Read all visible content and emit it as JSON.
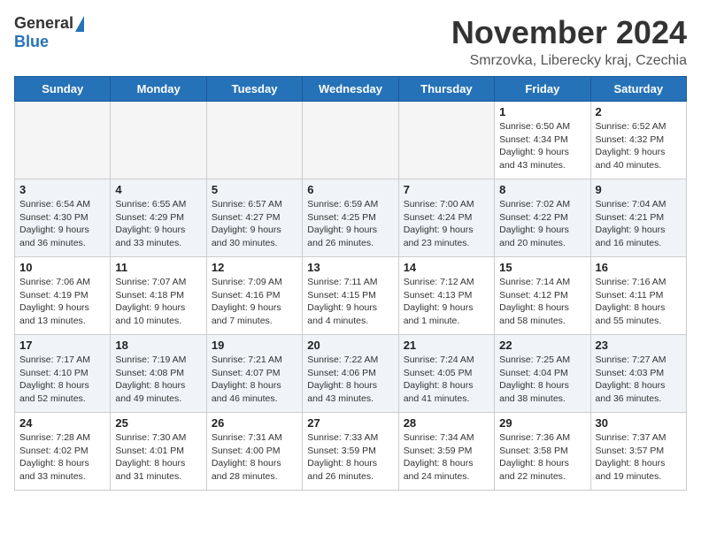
{
  "header": {
    "logo_general": "General",
    "logo_blue": "Blue",
    "title": "November 2024",
    "location": "Smrzovka, Liberecky kraj, Czechia"
  },
  "weekdays": [
    "Sunday",
    "Monday",
    "Tuesday",
    "Wednesday",
    "Thursday",
    "Friday",
    "Saturday"
  ],
  "weeks": [
    [
      {
        "day": "",
        "info": ""
      },
      {
        "day": "",
        "info": ""
      },
      {
        "day": "",
        "info": ""
      },
      {
        "day": "",
        "info": ""
      },
      {
        "day": "",
        "info": ""
      },
      {
        "day": "1",
        "info": "Sunrise: 6:50 AM\nSunset: 4:34 PM\nDaylight: 9 hours\nand 43 minutes."
      },
      {
        "day": "2",
        "info": "Sunrise: 6:52 AM\nSunset: 4:32 PM\nDaylight: 9 hours\nand 40 minutes."
      }
    ],
    [
      {
        "day": "3",
        "info": "Sunrise: 6:54 AM\nSunset: 4:30 PM\nDaylight: 9 hours\nand 36 minutes."
      },
      {
        "day": "4",
        "info": "Sunrise: 6:55 AM\nSunset: 4:29 PM\nDaylight: 9 hours\nand 33 minutes."
      },
      {
        "day": "5",
        "info": "Sunrise: 6:57 AM\nSunset: 4:27 PM\nDaylight: 9 hours\nand 30 minutes."
      },
      {
        "day": "6",
        "info": "Sunrise: 6:59 AM\nSunset: 4:25 PM\nDaylight: 9 hours\nand 26 minutes."
      },
      {
        "day": "7",
        "info": "Sunrise: 7:00 AM\nSunset: 4:24 PM\nDaylight: 9 hours\nand 23 minutes."
      },
      {
        "day": "8",
        "info": "Sunrise: 7:02 AM\nSunset: 4:22 PM\nDaylight: 9 hours\nand 20 minutes."
      },
      {
        "day": "9",
        "info": "Sunrise: 7:04 AM\nSunset: 4:21 PM\nDaylight: 9 hours\nand 16 minutes."
      }
    ],
    [
      {
        "day": "10",
        "info": "Sunrise: 7:06 AM\nSunset: 4:19 PM\nDaylight: 9 hours\nand 13 minutes."
      },
      {
        "day": "11",
        "info": "Sunrise: 7:07 AM\nSunset: 4:18 PM\nDaylight: 9 hours\nand 10 minutes."
      },
      {
        "day": "12",
        "info": "Sunrise: 7:09 AM\nSunset: 4:16 PM\nDaylight: 9 hours\nand 7 minutes."
      },
      {
        "day": "13",
        "info": "Sunrise: 7:11 AM\nSunset: 4:15 PM\nDaylight: 9 hours\nand 4 minutes."
      },
      {
        "day": "14",
        "info": "Sunrise: 7:12 AM\nSunset: 4:13 PM\nDaylight: 9 hours\nand 1 minute."
      },
      {
        "day": "15",
        "info": "Sunrise: 7:14 AM\nSunset: 4:12 PM\nDaylight: 8 hours\nand 58 minutes."
      },
      {
        "day": "16",
        "info": "Sunrise: 7:16 AM\nSunset: 4:11 PM\nDaylight: 8 hours\nand 55 minutes."
      }
    ],
    [
      {
        "day": "17",
        "info": "Sunrise: 7:17 AM\nSunset: 4:10 PM\nDaylight: 8 hours\nand 52 minutes."
      },
      {
        "day": "18",
        "info": "Sunrise: 7:19 AM\nSunset: 4:08 PM\nDaylight: 8 hours\nand 49 minutes."
      },
      {
        "day": "19",
        "info": "Sunrise: 7:21 AM\nSunset: 4:07 PM\nDaylight: 8 hours\nand 46 minutes."
      },
      {
        "day": "20",
        "info": "Sunrise: 7:22 AM\nSunset: 4:06 PM\nDaylight: 8 hours\nand 43 minutes."
      },
      {
        "day": "21",
        "info": "Sunrise: 7:24 AM\nSunset: 4:05 PM\nDaylight: 8 hours\nand 41 minutes."
      },
      {
        "day": "22",
        "info": "Sunrise: 7:25 AM\nSunset: 4:04 PM\nDaylight: 8 hours\nand 38 minutes."
      },
      {
        "day": "23",
        "info": "Sunrise: 7:27 AM\nSunset: 4:03 PM\nDaylight: 8 hours\nand 36 minutes."
      }
    ],
    [
      {
        "day": "24",
        "info": "Sunrise: 7:28 AM\nSunset: 4:02 PM\nDaylight: 8 hours\nand 33 minutes."
      },
      {
        "day": "25",
        "info": "Sunrise: 7:30 AM\nSunset: 4:01 PM\nDaylight: 8 hours\nand 31 minutes."
      },
      {
        "day": "26",
        "info": "Sunrise: 7:31 AM\nSunset: 4:00 PM\nDaylight: 8 hours\nand 28 minutes."
      },
      {
        "day": "27",
        "info": "Sunrise: 7:33 AM\nSunset: 3:59 PM\nDaylight: 8 hours\nand 26 minutes."
      },
      {
        "day": "28",
        "info": "Sunrise: 7:34 AM\nSunset: 3:59 PM\nDaylight: 8 hours\nand 24 minutes."
      },
      {
        "day": "29",
        "info": "Sunrise: 7:36 AM\nSunset: 3:58 PM\nDaylight: 8 hours\nand 22 minutes."
      },
      {
        "day": "30",
        "info": "Sunrise: 7:37 AM\nSunset: 3:57 PM\nDaylight: 8 hours\nand 19 minutes."
      }
    ]
  ]
}
